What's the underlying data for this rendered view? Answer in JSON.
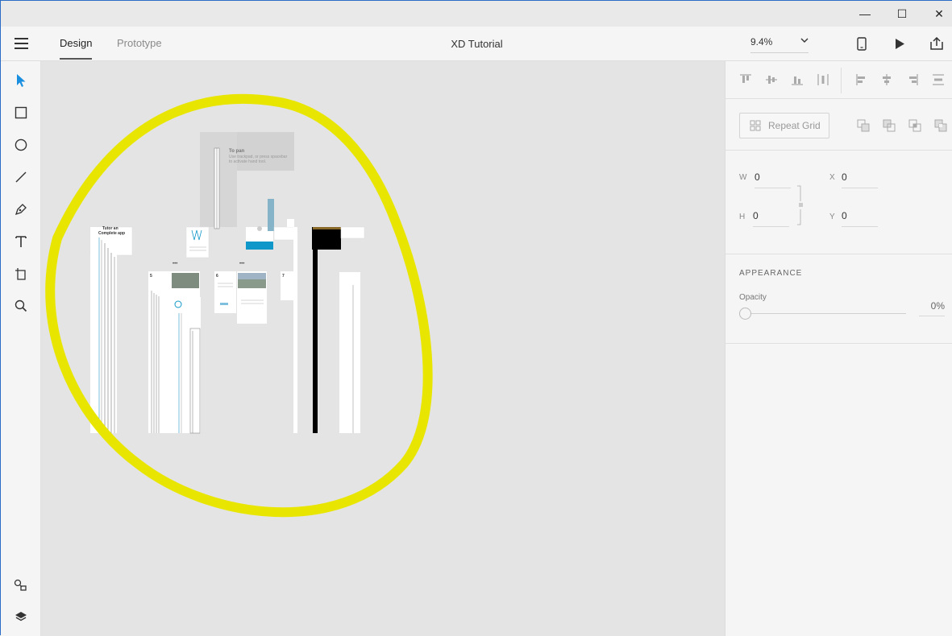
{
  "window": {
    "minimize_glyph": "—",
    "maximize_glyph": "☐",
    "close_glyph": "✕"
  },
  "header": {
    "tabs": [
      {
        "label": "Design",
        "active": true
      },
      {
        "label": "Prototype",
        "active": false
      }
    ],
    "document_title": "XD Tutorial",
    "zoom_value": "9.4%",
    "icons": [
      "hamburger-menu-icon",
      "mobile-preview-icon",
      "play-icon",
      "share-icon"
    ]
  },
  "toolbar": {
    "tools": [
      "select-icon",
      "rectangle-icon",
      "ellipse-icon",
      "line-icon",
      "pen-icon",
      "text-icon",
      "artboard-icon",
      "zoom-icon"
    ],
    "bottom_tools": [
      "assets-icon",
      "layers-icon"
    ]
  },
  "canvas": {
    "artboard_text": {
      "pan_title": "To pan",
      "pan_line1": "Use trackpad, or press spacebar",
      "pan_line2": "to activate hand tool.",
      "app_title_1": "Tutor an",
      "app_title_2": "Complete app",
      "num_5": "5",
      "num_6": "6",
      "num_7": "7",
      "dots": "•••"
    },
    "highlight_color": "#e8e600",
    "accent_blue": "#0f97c9"
  },
  "panel": {
    "repeat_grid_label": "Repeat Grid",
    "w_label": "W",
    "w_value": "0",
    "h_label": "H",
    "h_value": "0",
    "x_label": "X",
    "x_value": "0",
    "y_label": "Y",
    "y_value": "0",
    "appearance_title": "APPEARANCE",
    "opacity_label": "Opacity",
    "opacity_value": "0%",
    "opacity_fraction": 0
  }
}
